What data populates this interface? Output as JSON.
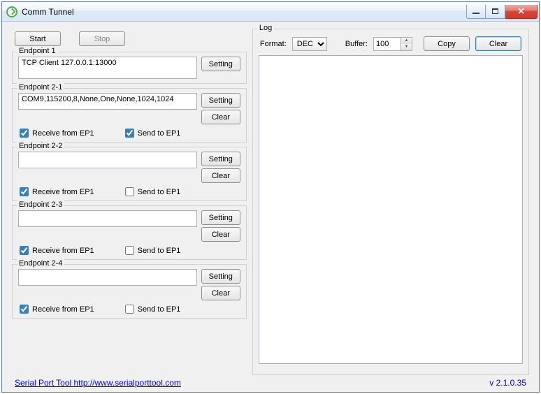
{
  "window": {
    "title": "Comm Tunnel"
  },
  "controls": {
    "start": "Start",
    "stop": "Stop"
  },
  "endpoints": {
    "ep1": {
      "legend": "Endpoint 1",
      "value": "TCP Client 127.0.0.1:13000",
      "setting": "Setting"
    },
    "ep21": {
      "legend": "Endpoint 2-1",
      "value": "COM9,115200,8,None,One,None,1024,1024",
      "setting": "Setting",
      "clear": "Clear",
      "recv": "Receive from EP1",
      "send": "Send to EP1"
    },
    "ep22": {
      "legend": "Endpoint 2-2",
      "value": "",
      "setting": "Setting",
      "clear": "Clear",
      "recv": "Receive from EP1",
      "send": "Send to EP1"
    },
    "ep23": {
      "legend": "Endpoint 2-3",
      "value": "",
      "setting": "Setting",
      "clear": "Clear",
      "recv": "Receive from EP1",
      "send": "Send to EP1"
    },
    "ep24": {
      "legend": "Endpoint 2-4",
      "value": "",
      "setting": "Setting",
      "clear": "Clear",
      "recv": "Receive from EP1",
      "send": "Send to EP1"
    }
  },
  "log": {
    "legend": "Log",
    "format_label": "Format:",
    "format_value": "DEC",
    "buffer_label": "Buffer:",
    "buffer_value": "100",
    "copy": "Copy",
    "clear": "Clear"
  },
  "footer": {
    "link_text": "Serial Port Tool    http://www.serialporttool.com",
    "link_url": "http://www.serialporttool.com",
    "version": "v 2.1.0.35"
  }
}
